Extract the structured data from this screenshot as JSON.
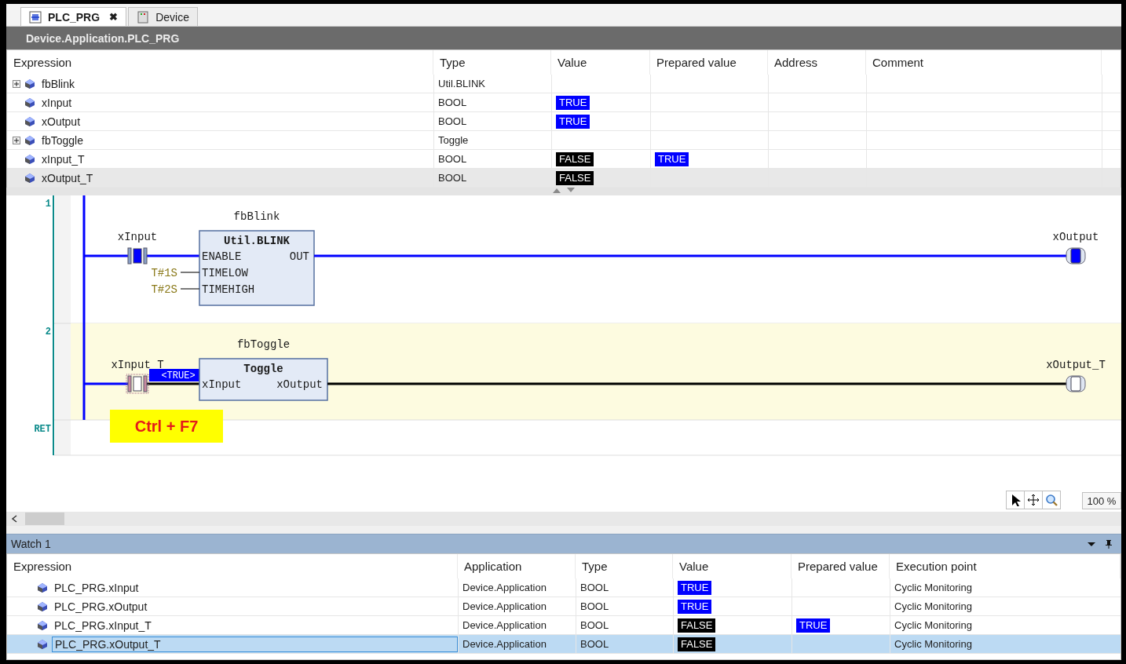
{
  "tabs": [
    {
      "label": "PLC_PRG",
      "selected": true,
      "kind": "program",
      "close": "✖"
    },
    {
      "label": "Device",
      "selected": false,
      "kind": "device"
    }
  ],
  "path": "Device.Application.PLC_PRG",
  "variables": {
    "columns": [
      "Expression",
      "Type",
      "Value",
      "Prepared value",
      "Address",
      "Comment"
    ],
    "rows": [
      {
        "expression": "fbBlink",
        "expandable": true,
        "type": "Util.BLINK",
        "selected": false
      },
      {
        "expression": "xInput",
        "expandable": false,
        "type": "BOOL",
        "value": {
          "text": "TRUE",
          "color": "#0000ff"
        },
        "selected": false
      },
      {
        "expression": "xOutput",
        "expandable": false,
        "type": "BOOL",
        "value": {
          "text": "TRUE",
          "color": "#0000ff"
        },
        "selected": false
      },
      {
        "expression": "fbToggle",
        "expandable": true,
        "type": "Toggle",
        "selected": false
      },
      {
        "expression": "xInput_T",
        "expandable": false,
        "type": "BOOL",
        "value": {
          "text": "FALSE",
          "color": "#000000"
        },
        "prepared": {
          "text": "TRUE",
          "color": "#0000ff"
        },
        "selected": false
      },
      {
        "expression": "xOutput_T",
        "expandable": false,
        "type": "BOOL",
        "value": {
          "text": "FALSE",
          "color": "#000000"
        },
        "selected": true
      }
    ]
  },
  "ladder": {
    "rungs": [
      {
        "number": "1",
        "highlighted": false,
        "instance": "fbBlink",
        "block_type": "Util.BLINK",
        "contact": {
          "name": "xInput",
          "energized": true,
          "selected": false
        },
        "inputs": [
          {
            "pin": "ENABLE"
          },
          {
            "pin": "TIMELOW",
            "constant": "T#1S"
          },
          {
            "pin": "TIMEHIGH",
            "constant": "T#2S"
          }
        ],
        "output": "OUT",
        "coil": {
          "name": "xOutput",
          "energized": true
        }
      },
      {
        "number": "2",
        "highlighted": true,
        "instance": "fbToggle",
        "block_type": "Toggle",
        "contact": {
          "name": "xInput_T",
          "energized": false,
          "selected": true,
          "prepared": "<TRUE>"
        },
        "inputs": [
          {
            "pin": "xInput"
          }
        ],
        "output": "xOutput",
        "coil": {
          "name": "xOutput_T",
          "energized": false
        }
      }
    ],
    "end_label": "RET",
    "callout": "Ctrl + F7",
    "zoom": "100 %"
  },
  "watch": {
    "title": "Watch 1",
    "columns": [
      "Expression",
      "Application",
      "Type",
      "Value",
      "Prepared value",
      "Execution point"
    ],
    "rows": [
      {
        "expression": "PLC_PRG.xInput",
        "application": "Device.Application",
        "type": "BOOL",
        "value": {
          "text": "TRUE",
          "color": "#0000ff"
        },
        "execution_point": "Cyclic Monitoring",
        "selected": false
      },
      {
        "expression": "PLC_PRG.xOutput",
        "application": "Device.Application",
        "type": "BOOL",
        "value": {
          "text": "TRUE",
          "color": "#0000ff"
        },
        "execution_point": "Cyclic Monitoring",
        "selected": false
      },
      {
        "expression": "PLC_PRG.xInput_T",
        "application": "Device.Application",
        "type": "BOOL",
        "value": {
          "text": "FALSE",
          "color": "#000000"
        },
        "prepared": {
          "text": "TRUE",
          "color": "#0000ff"
        },
        "execution_point": "Cyclic Monitoring",
        "selected": false
      },
      {
        "expression": "PLC_PRG.xOutput_T",
        "application": "Device.Application",
        "type": "BOOL",
        "value": {
          "text": "FALSE",
          "color": "#000000"
        },
        "execution_point": "Cyclic Monitoring",
        "selected": true
      }
    ]
  }
}
